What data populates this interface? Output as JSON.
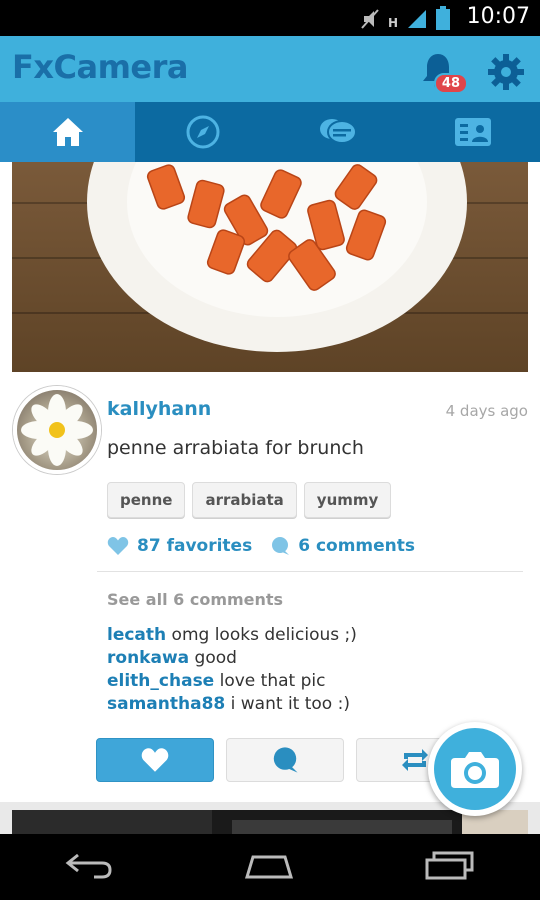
{
  "status": {
    "time": "10:07",
    "network": "H"
  },
  "app": {
    "title": "FxCamera",
    "notification_count": "48"
  },
  "tabs": [
    {
      "icon": "home-icon",
      "active": true
    },
    {
      "icon": "compass-icon",
      "active": false
    },
    {
      "icon": "chat-bubbles-icon",
      "active": false
    },
    {
      "icon": "contacts-icon",
      "active": false
    }
  ],
  "post": {
    "username": "kallyhann",
    "time_ago": "4 days ago",
    "caption": "penne arrabiata for brunch",
    "tags": [
      "penne",
      "arrabiata",
      "yummy"
    ],
    "favorites": "87 favorites",
    "comments_count": "6 comments",
    "see_all": "See all 6 comments",
    "comments": [
      {
        "user": "lecath",
        "text": "omg looks delicious ;)"
      },
      {
        "user": "ronkawa",
        "text": "good"
      },
      {
        "user": "elith_chase",
        "text": "love that pic"
      },
      {
        "user": "samantha88",
        "text": "i want it too :)"
      }
    ]
  },
  "colors": {
    "accent": "#3fb0dc",
    "tab_bar": "#0c6aa1",
    "link": "#2a8ec0",
    "badge": "#e0454a"
  }
}
